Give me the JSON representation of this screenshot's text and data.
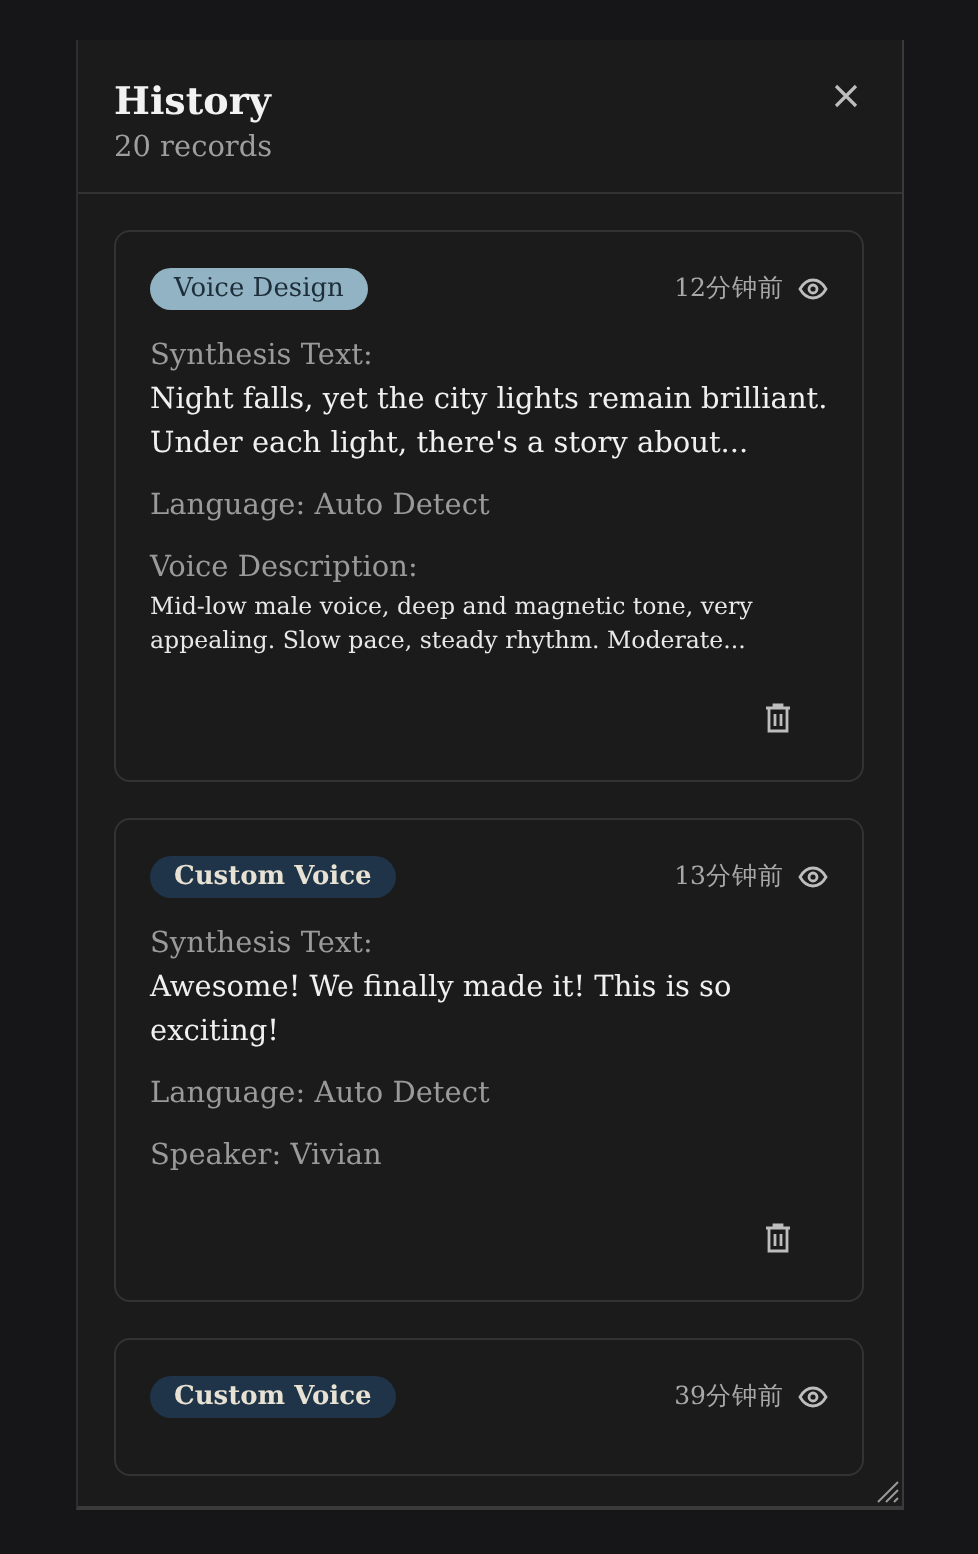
{
  "header": {
    "title": "History",
    "subtitle": "20 records"
  },
  "records": [
    {
      "tag": {
        "label": "Voice Design",
        "kind": "design"
      },
      "time": "12分钟前",
      "synthesis_label": "Synthesis Text:",
      "synthesis_text": "Night falls, yet the city lights remain brilliant. Under each light, there's a story about...",
      "language": "Language: Auto Detect",
      "extra": {
        "kind": "description",
        "label": "Voice Description:",
        "text": "Mid-low male voice, deep and magnetic tone, very appealing. Slow pace, steady rhythm. Moderate..."
      }
    },
    {
      "tag": {
        "label": "Custom Voice",
        "kind": "custom"
      },
      "time": "13分钟前",
      "synthesis_label": "Synthesis Text:",
      "synthesis_text": "Awesome! We finally made it! This is so exciting!",
      "language": "Language: Auto Detect",
      "extra": {
        "kind": "speaker",
        "text": "Speaker: Vivian"
      }
    },
    {
      "tag": {
        "label": "Custom Voice",
        "kind": "custom"
      },
      "time": "39分钟前"
    }
  ]
}
